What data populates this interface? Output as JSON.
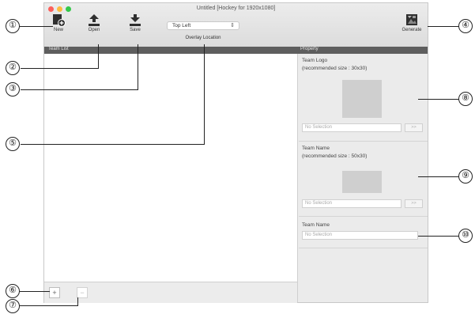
{
  "window": {
    "title": "Untitled  [Hockey for 1920x1080]",
    "traffic_lights": [
      "#fc605b",
      "#fdbc40",
      "#34c84a"
    ]
  },
  "toolbar": {
    "new_label": "New",
    "open_label": "Open",
    "save_label": "Save",
    "generate_label": "Generate",
    "overlay_location": {
      "value": "Top Left",
      "label": "Overlay Location"
    }
  },
  "team_list": {
    "header": "Team List",
    "add_label": "+",
    "remove_label": "−"
  },
  "property": {
    "header": "Property",
    "team_logo": {
      "title": "Team Logo",
      "hint": "(recommended size : 30x30)",
      "field_placeholder": "No Selection",
      "browse_label": ">>"
    },
    "team_name_image": {
      "title": "Team Name",
      "hint": "(recommended size : 50x30)",
      "field_placeholder": "No Selection",
      "browse_label": ">>"
    },
    "team_name_text": {
      "title": "Team Name",
      "field_placeholder": "No Selection"
    }
  },
  "callouts": [
    "①",
    "②",
    "③",
    "④",
    "⑤",
    "⑥",
    "⑦",
    "⑧",
    "⑨",
    "⑩"
  ]
}
